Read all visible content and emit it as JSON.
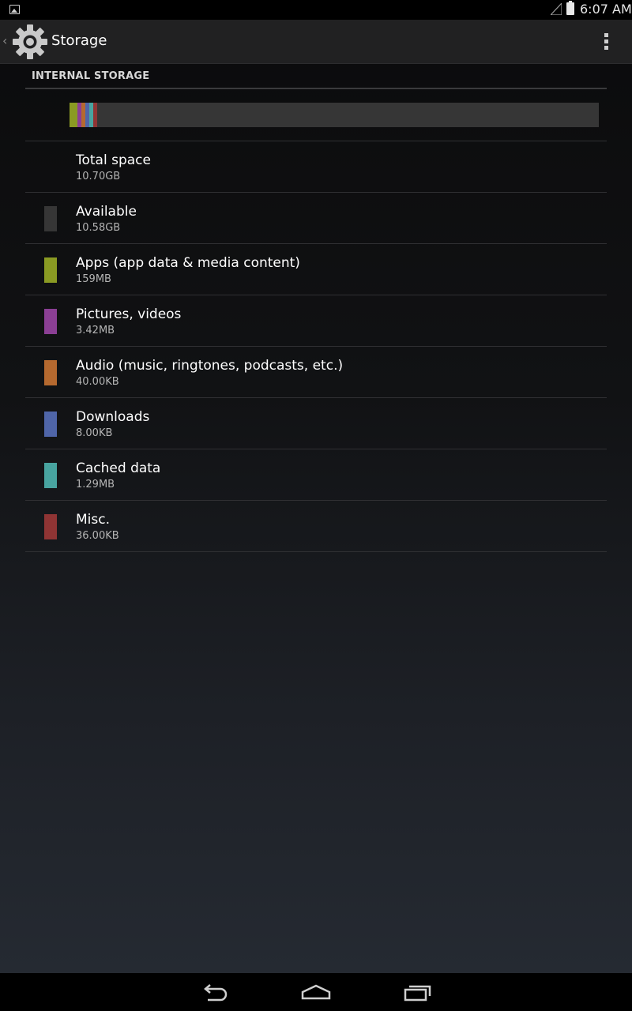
{
  "status_bar": {
    "time": "6:07 AM",
    "icons": [
      "gallery-notification-icon",
      "signal-icon",
      "battery-icon"
    ]
  },
  "action_bar": {
    "title": "Storage",
    "app_icon": "settings-gear-icon",
    "menu_icon": "overflow-menu-icon"
  },
  "section": {
    "header": "INTERNAL STORAGE"
  },
  "usage_bar": {
    "background": "#363636",
    "segments": [
      {
        "name": "apps",
        "color": "#8a9a23",
        "fraction": 0.0149
      },
      {
        "name": "pictures",
        "color": "#8b3f94",
        "fraction": 0.0003
      },
      {
        "name": "audio",
        "color": "#b5692f",
        "fraction": 1e-05
      },
      {
        "name": "downloads",
        "color": "#4f65a8",
        "fraction": 1e-06
      },
      {
        "name": "cached",
        "color": "#48a4a0",
        "fraction": 0.0001
      },
      {
        "name": "misc",
        "color": "#8f3434",
        "fraction": 1e-05
      }
    ]
  },
  "rows": [
    {
      "id": "total",
      "label": "Total space",
      "value": "10.70GB",
      "color": null
    },
    {
      "id": "available",
      "label": "Available",
      "value": "10.58GB",
      "color": "#363636"
    },
    {
      "id": "apps",
      "label": "Apps (app data & media content)",
      "value": "159MB",
      "color": "#8a9a23"
    },
    {
      "id": "pictures",
      "label": "Pictures, videos",
      "value": "3.42MB",
      "color": "#8b3f94"
    },
    {
      "id": "audio",
      "label": "Audio (music, ringtones, podcasts, etc.)",
      "value": "40.00KB",
      "color": "#b5692f"
    },
    {
      "id": "downloads",
      "label": "Downloads",
      "value": "8.00KB",
      "color": "#4f65a8"
    },
    {
      "id": "cached",
      "label": "Cached data",
      "value": "1.29MB",
      "color": "#48a4a0"
    },
    {
      "id": "misc",
      "label": "Misc.",
      "value": "36.00KB",
      "color": "#8f3434"
    }
  ],
  "nav_bar": {
    "buttons": [
      "back-icon",
      "home-icon",
      "recent-apps-icon"
    ]
  }
}
